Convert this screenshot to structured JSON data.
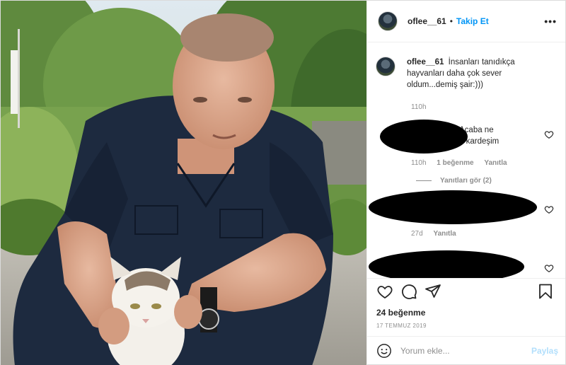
{
  "post": {
    "username": "oflee__61",
    "separator": "•",
    "follow_label": "Takip Et",
    "more_label": "•••",
    "photo_icon": "photo-of-man-holding-kitten"
  },
  "caption": {
    "username": "oflee__61",
    "text": "İnsanları tanıdıkça hayvanları daha çok sever oldum...demiş şair:)))",
    "time": "110h"
  },
  "comments": [
    {
      "visible_text_line1": "Acaba ne",
      "visible_text_line2": "n kardeşim",
      "time": "110h",
      "likes": "1 beğenme",
      "reply_label": "Yanıtla",
      "view_replies": "Yanıtları gör (2)",
      "redacted": true
    },
    {
      "time": "27d",
      "reply_label": "Yanıtla",
      "redacted": true
    },
    {
      "redacted": true
    }
  ],
  "actions": {
    "icons": [
      "heart-icon",
      "comment-icon",
      "share-icon",
      "bookmark-icon"
    ]
  },
  "likes_count": "24 beğenme",
  "post_date": "17 TEMMUZ 2019",
  "add_comment": {
    "placeholder": "Yorum ekle...",
    "post_label": "Paylaş",
    "emoji_icon": "smile-icon"
  },
  "colors": {
    "accent": "#0095f6",
    "accent_disabled": "#b2dffc",
    "text": "#262626",
    "muted": "#8e8e8e",
    "border": "#efefef"
  }
}
